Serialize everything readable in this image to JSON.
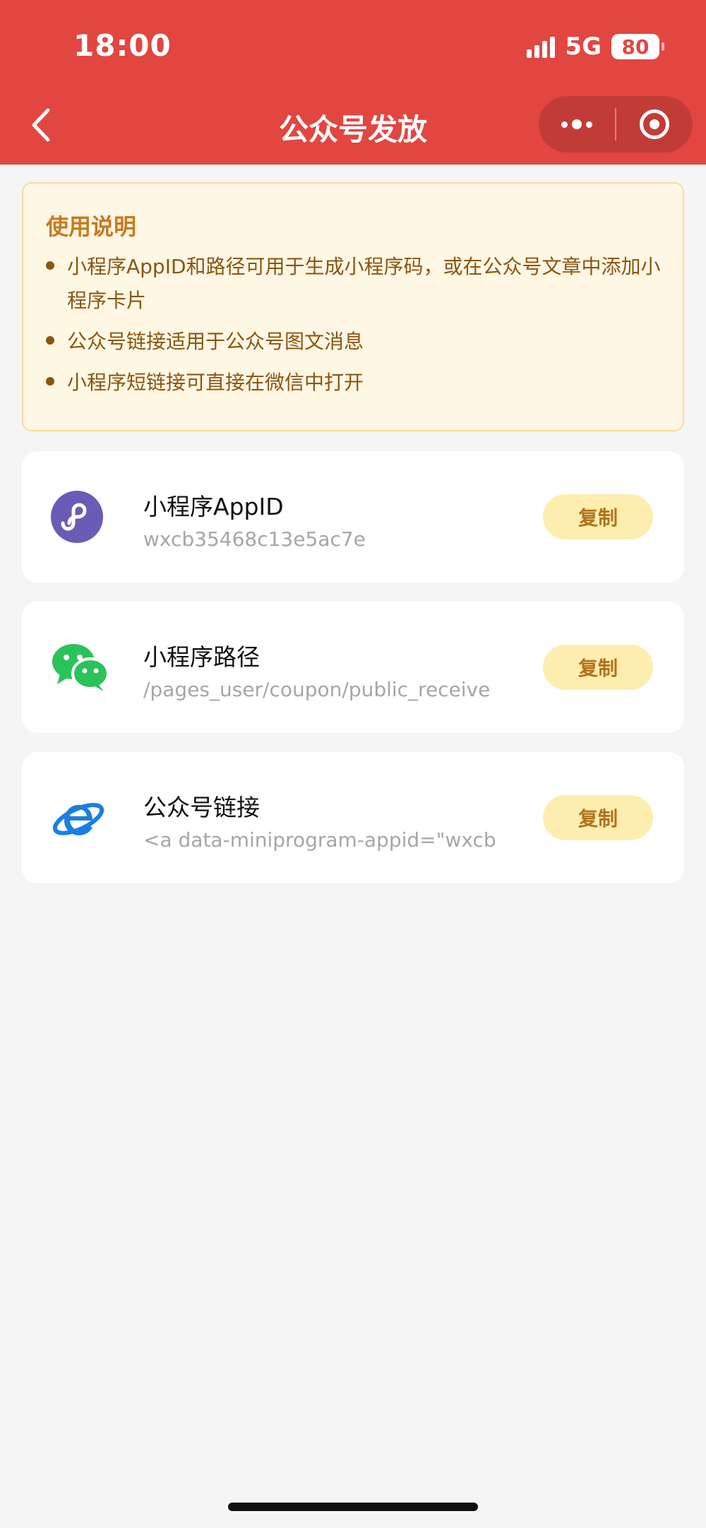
{
  "status_bar": {
    "time": "18:00",
    "network": "5G",
    "battery": "80"
  },
  "nav": {
    "title": "公众号发放"
  },
  "notice": {
    "title": "使用说明",
    "items": [
      "小程序AppID和路径可用于生成小程序码，或在公众号文章中添加小程序卡片",
      "公众号链接适用于公众号图文消息",
      "小程序短链接可直接在微信中打开"
    ]
  },
  "cards": [
    {
      "icon": "mini-program-icon",
      "label": "小程序AppID",
      "value": "wxcb35468c13e5ac7e",
      "button": "复制"
    },
    {
      "icon": "wechat-icon",
      "label": "小程序路径",
      "value": "/pages_user/coupon/public_receive",
      "button": "复制"
    },
    {
      "icon": "browser-link-icon",
      "label": "公众号链接",
      "value": "<a data-miniprogram-appid=\"wxcb",
      "button": "复制"
    }
  ],
  "colors": {
    "header": "#e24641",
    "notice_bg": "#fef7e4",
    "notice_title": "#c87a1f",
    "button_bg": "#fdeeb0",
    "button_text": "#b3721c"
  }
}
